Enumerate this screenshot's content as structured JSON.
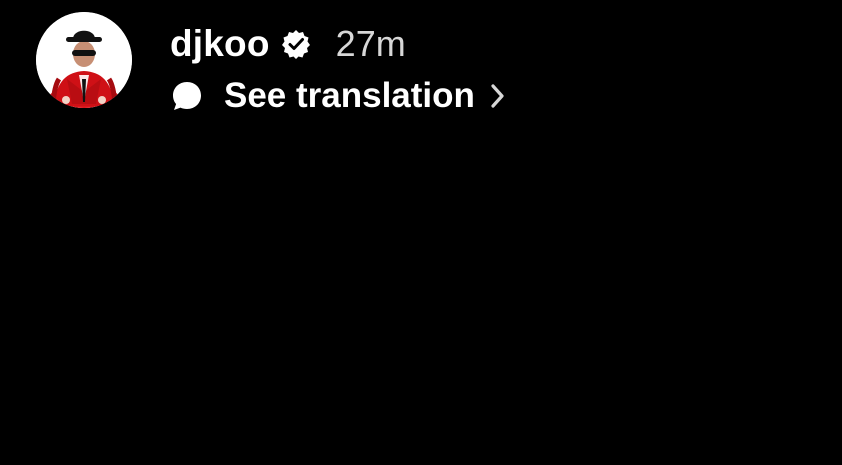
{
  "post": {
    "username": "djkoo",
    "timestamp": "27m",
    "translate_label": "See translation",
    "avatar_icon": "avatar",
    "verified_icon": "verified-badge-icon",
    "bubble_icon": "speech-bubble-icon",
    "chevron_icon": "chevron-right-icon"
  },
  "colors": {
    "background": "#000000",
    "text": "#ffffff",
    "muted_text": "#d7d7d7",
    "avatar_jacket": "#d9161c"
  }
}
